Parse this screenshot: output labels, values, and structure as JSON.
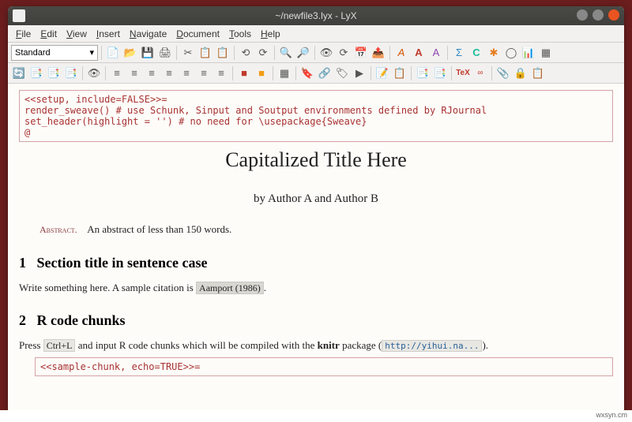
{
  "window": {
    "title": "~/newfile3.lyx - LyX"
  },
  "menubar": [
    {
      "label": "File",
      "u": 0
    },
    {
      "label": "Edit",
      "u": 0
    },
    {
      "label": "View",
      "u": 0
    },
    {
      "label": "Insert",
      "u": 0
    },
    {
      "label": "Navigate",
      "u": 0
    },
    {
      "label": "Document",
      "u": 0
    },
    {
      "label": "Tools",
      "u": 0
    },
    {
      "label": "Help",
      "u": 0
    }
  ],
  "style_selector": "Standard",
  "icons": {
    "row1": [
      "📄",
      "📂",
      "💾",
      "🖨",
      "✂",
      "📋",
      "📋",
      "⟲",
      "⟳",
      "🔍",
      "🔍",
      "👁",
      "⟳",
      "📅",
      "📤",
      "𝑨",
      "🅰",
      "𝐴",
      "Σ",
      "𝑪",
      "✱",
      "◯",
      "📊",
      "▦"
    ],
    "row2": [
      "⟲",
      "🅱",
      "🅱",
      "🅱",
      "│",
      "👁",
      "│",
      "≡",
      "≡",
      "≡",
      "≡",
      "≡",
      "≡",
      "≡",
      "│",
      "⬛",
      "⬛",
      "│",
      "▦",
      "│",
      "🔖",
      "🔗",
      "🏷",
      "▶",
      "│",
      "📝",
      "📋",
      "│",
      "📑",
      "📑",
      "│",
      "TeX",
      "Woo",
      "│",
      "🔗",
      "🔒",
      "📋"
    ]
  },
  "doc": {
    "code1": "<<setup, include=FALSE>>=\nrender_sweave() # use Schunk, Sinput and Soutput environments defined by RJournal\nset_header(highlight = '') # no need for \\usepackage{Sweave}\n@",
    "title": "Capitalized Title Here",
    "author": "by Author A and Author B",
    "abstract_label": "Abstract.",
    "abstract_text": "An abstract of less than 150 words.",
    "section1_num": "1",
    "section1_title": "Section title in sentence case",
    "p1_a": "Write something here. A sample citation is ",
    "cite1": "Aamport (1986)",
    "p1_b": ".",
    "section2_num": "2",
    "section2_title": "R code chunks",
    "p2_a": "Press ",
    "key": "Ctrl+L",
    "p2_b": " and input R code chunks which will be compiled with the ",
    "knitr": "knitr",
    "p2_c": " package (",
    "link": "http://yihui.na...",
    "p2_d": ").",
    "code2": "<<sample-chunk, echo=TRUE>>="
  },
  "footer": "wxsyn.cm"
}
